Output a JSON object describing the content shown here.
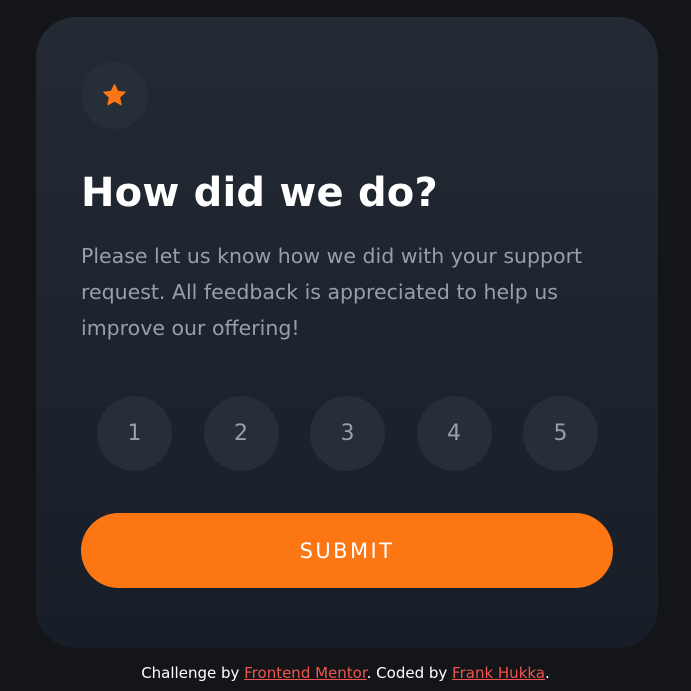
{
  "card": {
    "title": "How did we do?",
    "description": "Please let us know how we did with your support request. All feedback is appreciated to help us improve our offering!",
    "ratings": [
      "1",
      "2",
      "3",
      "4",
      "5"
    ],
    "submit_label": "SUBMIT"
  },
  "footer": {
    "challenge_prefix": "Challenge by ",
    "challenge_link": "Frontend Mentor",
    "coded_prefix": ". Coded by ",
    "author_link": "Frank Hukka",
    "suffix": "."
  },
  "icons": {
    "badge": "star-icon"
  },
  "colors": {
    "page_background": "#131518",
    "card_background": "#1f2630",
    "accent": "#fc7614",
    "muted_text": "#969fad",
    "rating_background": "#262e38",
    "link": "#f0544b"
  }
}
